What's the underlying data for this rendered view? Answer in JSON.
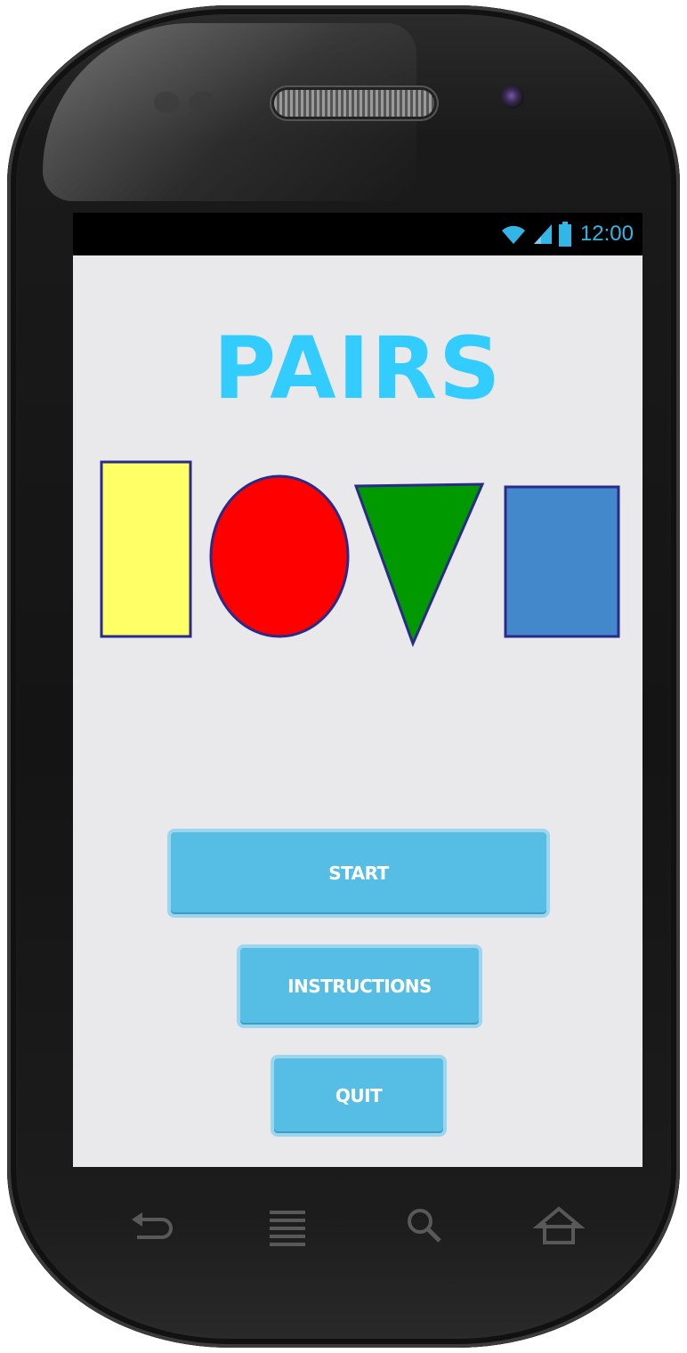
{
  "status_bar": {
    "time": "12:00",
    "icons": [
      "wifi-icon",
      "signal-icon",
      "battery-icon"
    ],
    "time_color": "#33b5e5"
  },
  "app": {
    "title": "PAIRS",
    "title_color": "#33ccff",
    "shapes": [
      {
        "name": "rectangle",
        "fill": "#ffff66"
      },
      {
        "name": "circle",
        "fill": "#ff0000"
      },
      {
        "name": "triangle",
        "fill": "#009900"
      },
      {
        "name": "square",
        "fill": "#4488cc"
      }
    ],
    "shape_stroke": "#2a2a8a"
  },
  "buttons": {
    "start_label": "START",
    "instructions_label": "INSTRUCTIONS",
    "quit_label": "QUIT",
    "color": "#56bde4"
  },
  "nav_bar": {
    "icons": [
      "back-icon",
      "menu-icon",
      "search-icon",
      "home-icon"
    ]
  }
}
